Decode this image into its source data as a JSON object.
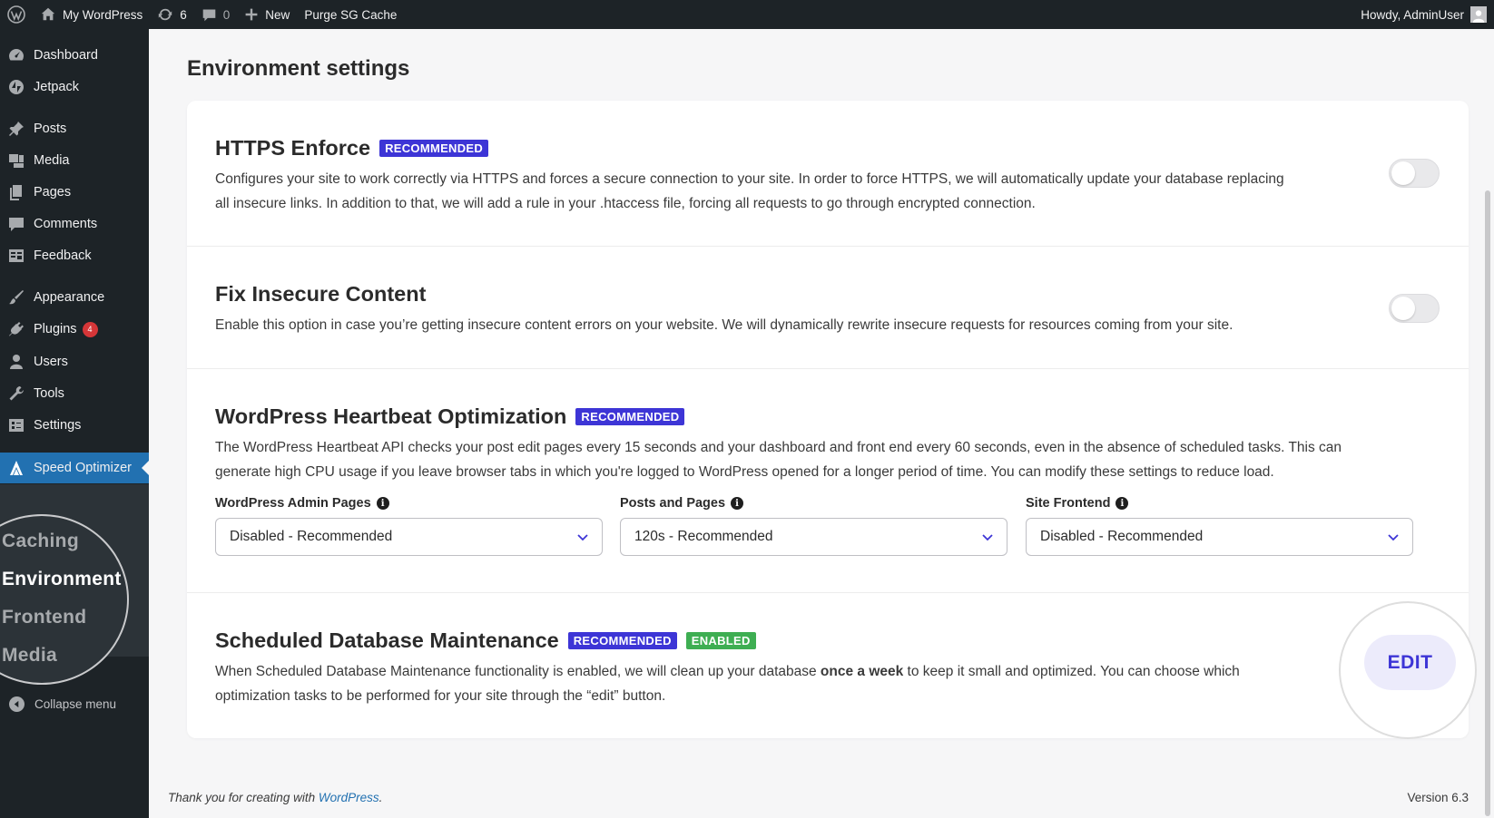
{
  "adminbar": {
    "site_name": "My WordPress",
    "updates_count": "6",
    "comments_count": "0",
    "new_label": "New",
    "purge_label": "Purge SG Cache",
    "howdy": "Howdy, AdminUser"
  },
  "sidebar": {
    "items": [
      {
        "label": "Dashboard",
        "icon": "dashboard-icon"
      },
      {
        "label": "Jetpack",
        "icon": "jetpack-icon"
      },
      {
        "label": "Posts",
        "icon": "pin-icon"
      },
      {
        "label": "Media",
        "icon": "media-icon"
      },
      {
        "label": "Pages",
        "icon": "pages-icon"
      },
      {
        "label": "Comments",
        "icon": "comment-icon"
      },
      {
        "label": "Feedback",
        "icon": "feedback-icon"
      },
      {
        "label": "Appearance",
        "icon": "brush-icon"
      },
      {
        "label": "Plugins",
        "icon": "plugin-icon",
        "badge": "4"
      },
      {
        "label": "Users",
        "icon": "user-icon"
      },
      {
        "label": "Tools",
        "icon": "wrench-icon"
      },
      {
        "label": "Settings",
        "icon": "settings-icon"
      },
      {
        "label": "Speed Optimizer",
        "icon": "speed-optimizer-icon"
      }
    ],
    "submenu": [
      "Caching",
      "Environment",
      "Frontend",
      "Media"
    ],
    "submenu_ghost": "ce",
    "collapse_label": "Collapse menu"
  },
  "main": {
    "page_title": "Environment settings",
    "sections": {
      "https": {
        "title": "HTTPS Enforce",
        "tag": "RECOMMENDED",
        "desc_line1": "Configures your site to work correctly via HTTPS and forces a secure connection to your site. In order to force HTTPS, we will automatically update your database replacing",
        "desc_line2": "all insecure links. In addition to that, we will add a rule in your .htaccess file, forcing all requests to go through encrypted connection."
      },
      "insecure": {
        "title": "Fix Insecure Content",
        "desc": "Enable this option in case you’re getting insecure content errors on your website. We will dynamically rewrite insecure requests for resources coming from your site."
      },
      "heartbeat": {
        "title": "WordPress Heartbeat Optimization",
        "tag": "RECOMMENDED",
        "desc_line1": "The WordPress Heartbeat API checks your post edit pages every 15 seconds and your dashboard and front end every 60 seconds, even in the absence of scheduled tasks. This can",
        "desc_line2": "generate high CPU usage if you leave browser tabs in which you're logged to WordPress opened for a longer period of time. You can modify these settings to reduce load.",
        "fields": [
          {
            "label": "WordPress Admin Pages",
            "value": "Disabled - Recommended"
          },
          {
            "label": "Posts and Pages",
            "value": "120s - Recommended"
          },
          {
            "label": "Site Frontend",
            "value": "Disabled - Recommended"
          }
        ]
      },
      "dbmaint": {
        "title": "Scheduled Database Maintenance",
        "tag": "RECOMMENDED",
        "tag2": "ENABLED",
        "desc_pre": "When Scheduled Database Maintenance functionality is enabled, we will clean up your database ",
        "desc_bold": "once a week",
        "desc_post": " to keep it small and optimized. You can choose which",
        "desc_line2": "optimization tasks to be performed for your site through the “edit” button.",
        "edit_label": "EDIT"
      }
    }
  },
  "footer": {
    "thanks_pre": "Thank you for creating with ",
    "thanks_link": "WordPress",
    "thanks_post": ".",
    "version": "Version 6.3"
  },
  "colors": {
    "accent": "#3d35d6",
    "enabled": "#3eae52",
    "wp_blue": "#2271b1",
    "admin_dark": "#1d2327"
  }
}
